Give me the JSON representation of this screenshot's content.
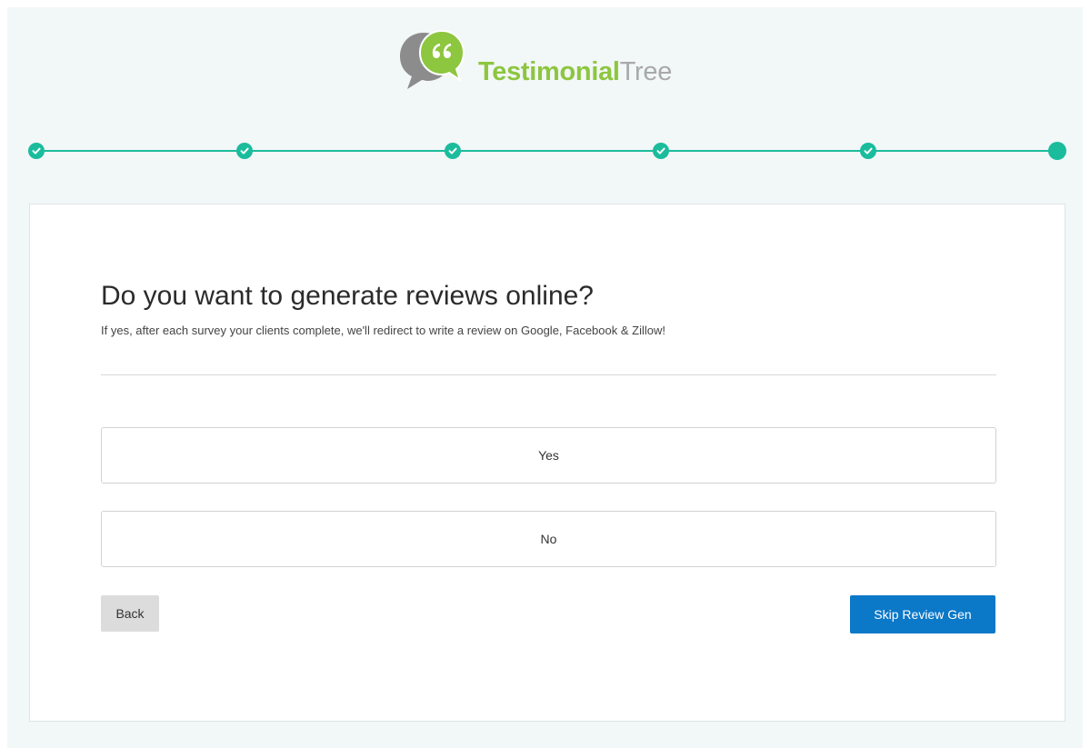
{
  "brand": {
    "name_bold": "Testimonial",
    "name_light": "Tree",
    "colors": {
      "green": "#8dc63f",
      "gray": "#a9a9a9",
      "bubble_gray": "#8c8c8c"
    }
  },
  "stepper": {
    "accent": "#1abc9c",
    "steps": [
      {
        "state": "complete",
        "icon": "check-icon"
      },
      {
        "state": "complete",
        "icon": "check-icon"
      },
      {
        "state": "complete",
        "icon": "check-icon"
      },
      {
        "state": "complete",
        "icon": "check-icon"
      },
      {
        "state": "complete",
        "icon": "check-icon"
      },
      {
        "state": "current",
        "icon": "dot-icon"
      }
    ]
  },
  "main": {
    "title": "Do you want to generate reviews online?",
    "subtitle": "If yes, after each survey your clients complete, we'll redirect to write a review on Google, Facebook & Zillow!",
    "options": [
      {
        "label": "Yes"
      },
      {
        "label": "No"
      }
    ],
    "back_label": "Back",
    "skip_label": "Skip Review Gen",
    "skip_color": "#0b78c8"
  }
}
